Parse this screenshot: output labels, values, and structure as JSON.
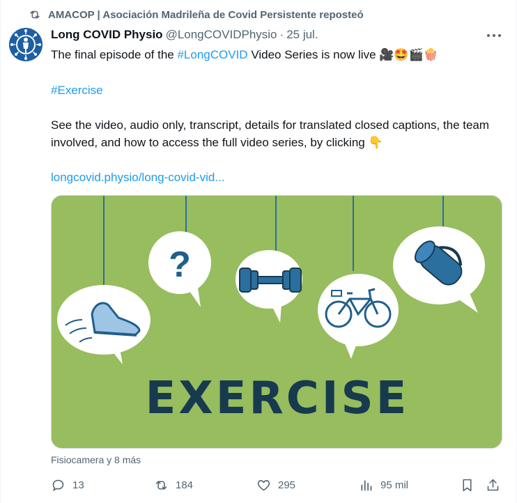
{
  "repost": {
    "text": "AMACOP | Asociación Madrileña de Covid Persistente reposteó"
  },
  "author": {
    "name": "Long COVID Physio",
    "handle": "@LongCOVIDPhysio",
    "separator": "·",
    "date": "25 jul."
  },
  "content": {
    "line1_pre": "The final episode of the ",
    "hashtag1": "#LongCOVID",
    "line1_post": " Video Series is now live ",
    "emojis": "🎥🤩🎬🍿",
    "hashtag2": "#Exercise",
    "para": "See the video, audio only, transcript, details for translated closed captions, the team involved, and how to access the full video series, by clicking 👇",
    "link": "longcovid.physio/long-covid-vid..."
  },
  "media": {
    "word": "EXERCISE",
    "bg_color": "#97bd5e",
    "text_color": "#173a4f",
    "accent": "#2b6f9e"
  },
  "tag_line": "Fisiocamera y 8 más",
  "actions": {
    "replies": "13",
    "reposts": "184",
    "likes": "295",
    "views": "95 mil"
  }
}
